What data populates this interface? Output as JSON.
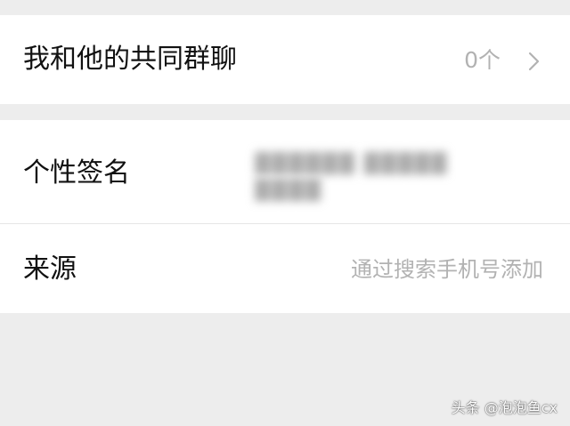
{
  "groups": {
    "label": "我和他的共同群聊",
    "count": "0个"
  },
  "signature": {
    "label": "个性签名",
    "line1": "▓▓▓▓▓▓ ▓▓▓▓▓",
    "line2": "▓▓▓▓"
  },
  "source": {
    "label": "来源",
    "value": "通过搜索手机号添加"
  },
  "watermark": "头条 @泡泡鱼cx",
  "colors": {
    "background": "#ededed",
    "card": "#ffffff",
    "label_text": "#111111",
    "secondary_text": "#b2b2b2"
  },
  "icons": {
    "chevron": "chevron-right-icon"
  }
}
